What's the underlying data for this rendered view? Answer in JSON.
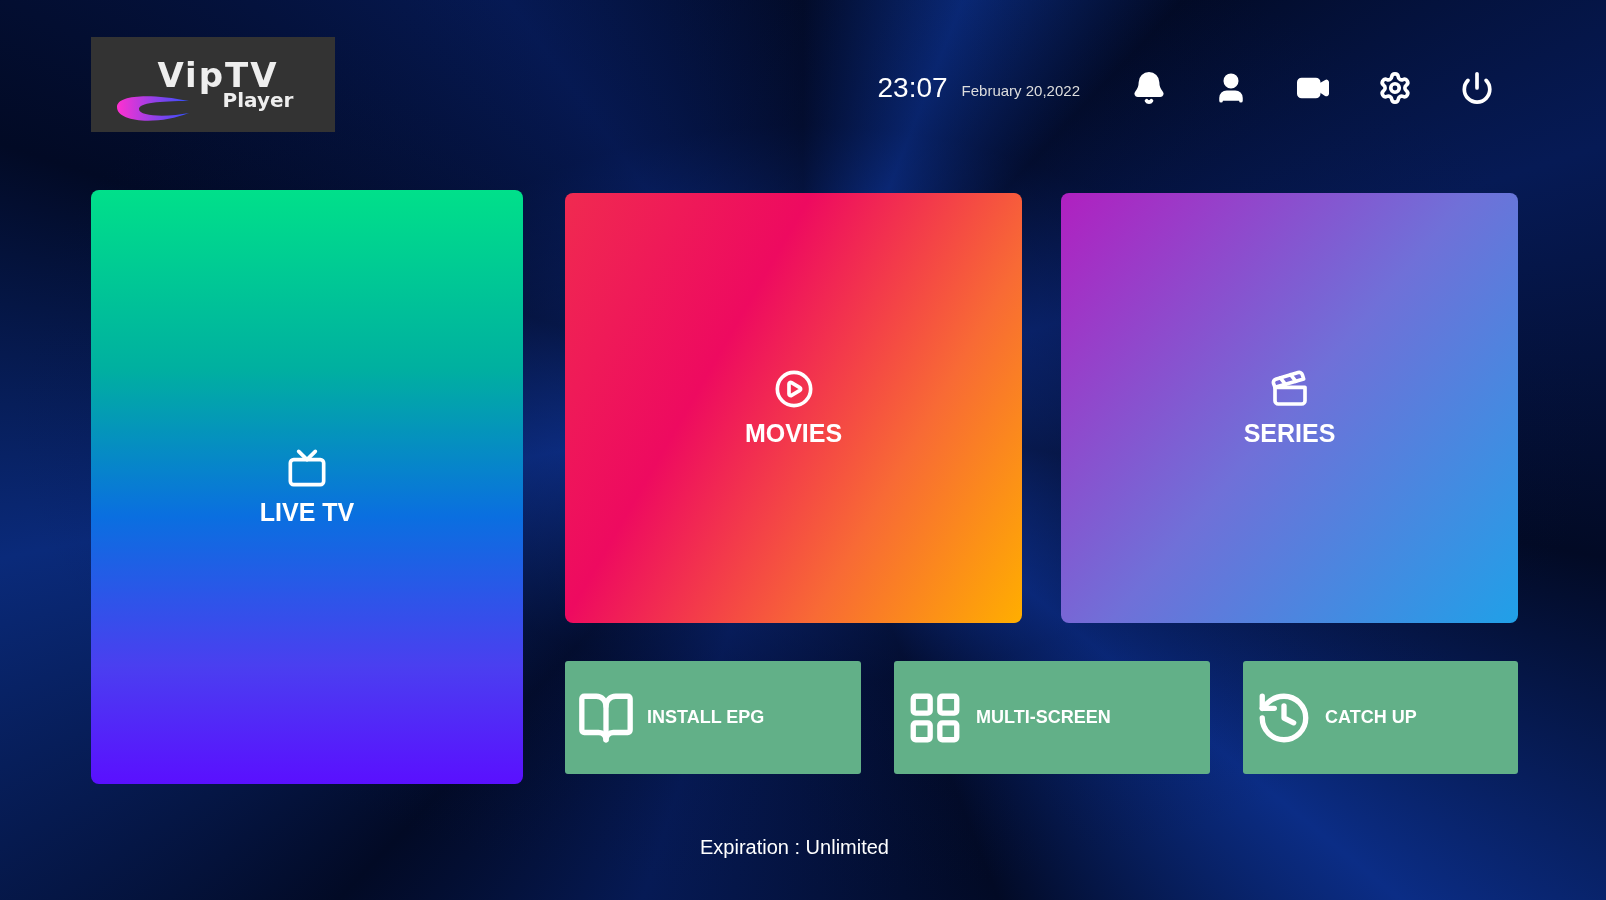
{
  "logo": {
    "title": "VipTV",
    "subtitle": "Player"
  },
  "header": {
    "time": "23:07",
    "date": "February 20,2022",
    "icons": [
      {
        "kind": "bell"
      },
      {
        "kind": "user"
      },
      {
        "kind": "video"
      },
      {
        "kind": "settings"
      },
      {
        "kind": "power"
      }
    ]
  },
  "tiles": [
    {
      "kind": "live",
      "label": "LIVE TV"
    },
    {
      "kind": "movies",
      "label": "MOVIES"
    },
    {
      "kind": "series",
      "label": "SERIES"
    }
  ],
  "actions": [
    {
      "kind": "epg",
      "label": "INSTALL EPG"
    },
    {
      "kind": "multi",
      "label": "MULTI-SCREEN"
    },
    {
      "kind": "catchup",
      "label": "CATCH UP"
    }
  ],
  "footer": {
    "expiration": "Expiration : Unlimited"
  }
}
